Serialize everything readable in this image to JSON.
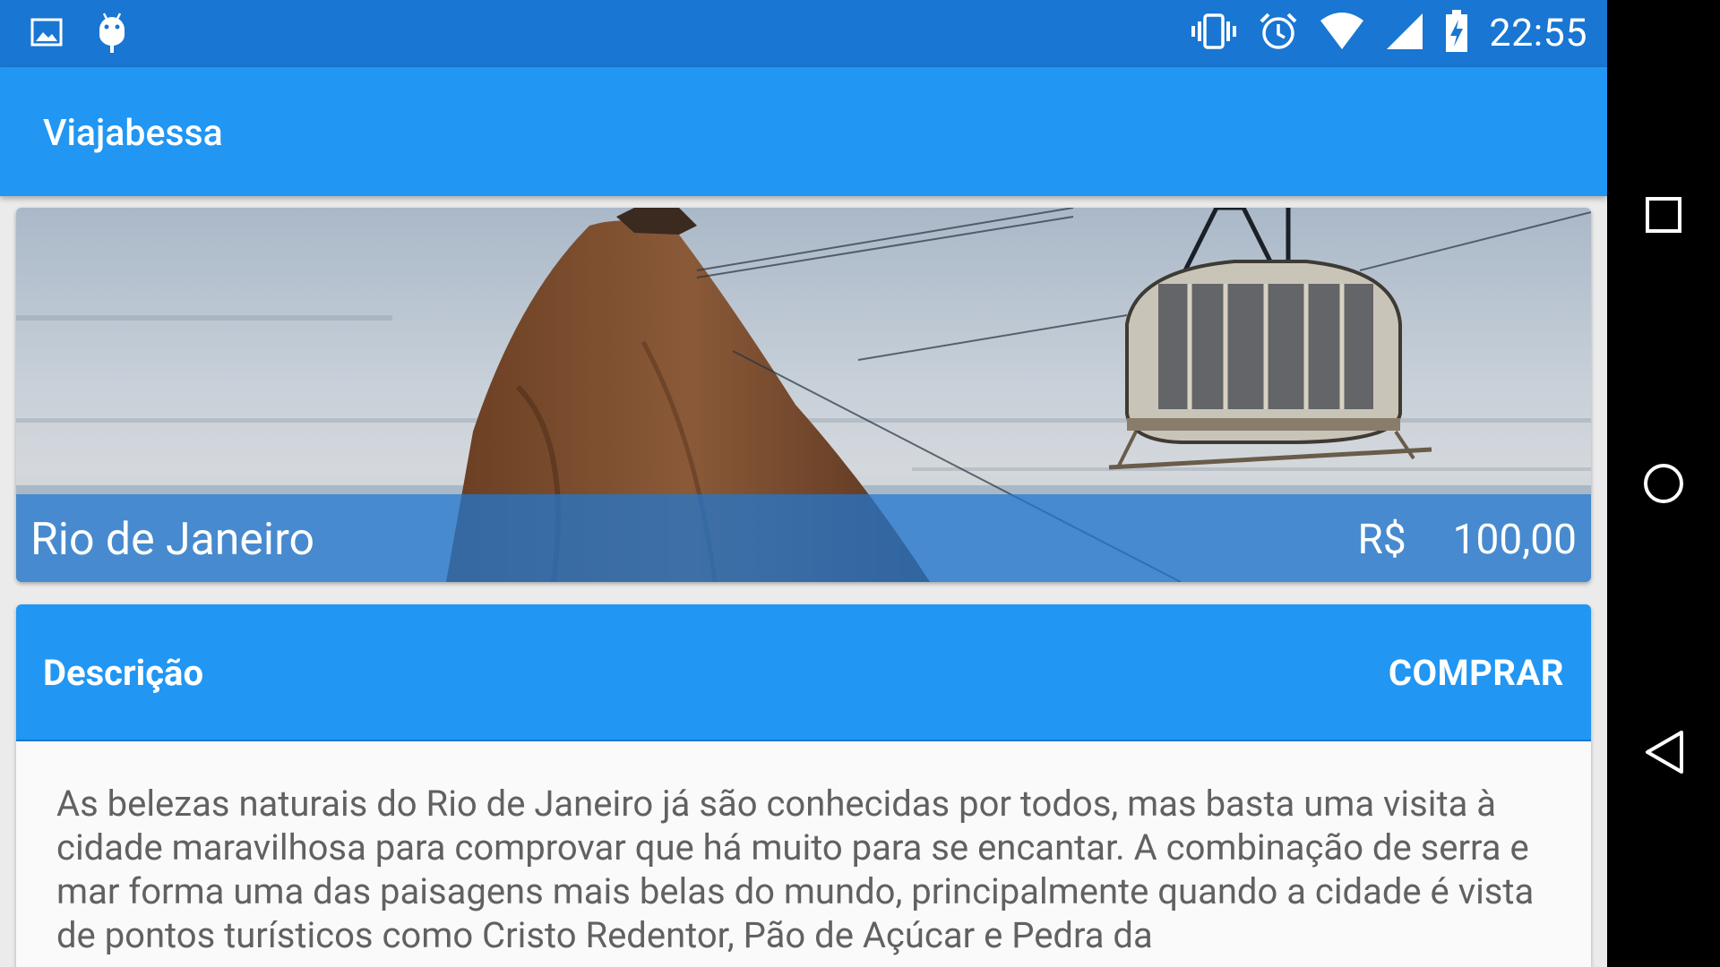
{
  "status_bar": {
    "time": "22:55",
    "icons_left": [
      "image-icon",
      "android-icon"
    ],
    "icons_right": [
      "vibrate-icon",
      "alarm-icon",
      "wifi-icon",
      "signal-icon",
      "battery-charging-icon"
    ]
  },
  "app_bar": {
    "title": "Viajabessa"
  },
  "hero": {
    "destination": "Rio de Janeiro",
    "currency": "R$",
    "price": "100,00"
  },
  "description": {
    "header": "Descrição",
    "buy_label": "COMPRAR",
    "text": "As belezas naturais do Rio de Janeiro já são conhecidas por todos, mas basta uma visita à cidade maravilhosa para comprovar que há muito para se encantar. A combinação de serra e mar forma uma das paisagens mais belas do mundo, principalmente quando a cidade é vista de pontos turísticos como Cristo Redentor, Pão de Açúcar e Pedra da"
  },
  "nav": {
    "items": [
      "recents-icon",
      "home-icon",
      "back-icon"
    ]
  },
  "colors": {
    "primary": "#2196f3",
    "primary_dark": "#1976d2",
    "text_secondary": "#616161"
  }
}
